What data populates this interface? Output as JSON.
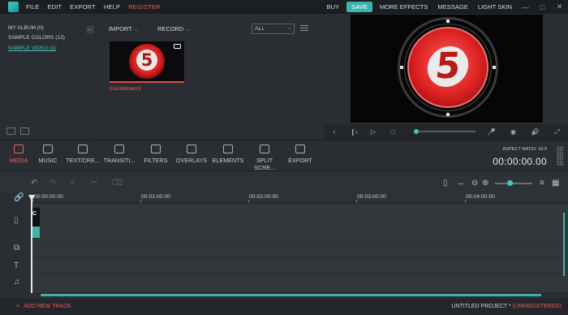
{
  "menu": {
    "items": [
      "FILE",
      "EDIT",
      "EXPORT",
      "HELP"
    ],
    "register": "REGISTER"
  },
  "topbar": {
    "buy": "BUY",
    "save": "SAVE",
    "more_effects": "MORE EFFECTS",
    "message": "MESSAGE",
    "light_skin": "LIGHT SKIN"
  },
  "sidebar": {
    "items": [
      {
        "label": "MY ALBUM (0)"
      },
      {
        "label": "SAMPLE COLORS (13)"
      },
      {
        "label": "SAMPLE VIDEO (1)",
        "active": true
      }
    ]
  },
  "media": {
    "import_label": "IMPORT",
    "record_label": "RECORD",
    "filter_value": "ALL",
    "clip_name": "Countdown3",
    "thumb_digit": "5"
  },
  "preview": {
    "digit": "5"
  },
  "tools": [
    {
      "label": "MEDIA",
      "icon": "folder-icon",
      "active": true
    },
    {
      "label": "MUSIC",
      "icon": "music-note-icon"
    },
    {
      "label": "TEXT/CRE...",
      "icon": "text-icon"
    },
    {
      "label": "TRANSITI...",
      "icon": "transition-icon"
    },
    {
      "label": "FILTERS",
      "icon": "filters-icon"
    },
    {
      "label": "OVERLAYS",
      "icon": "overlays-icon"
    },
    {
      "label": "ELEMENTS",
      "icon": "image-icon"
    },
    {
      "label": "SPLIT SCRE...",
      "icon": "split-screen-icon"
    },
    {
      "label": "EXPORT",
      "icon": "export-icon"
    }
  ],
  "aspect_ratio": "ASPECT RATIO: 16:9",
  "timecode": "00:00:00.00",
  "timeline": {
    "ruler": [
      "00:00:00:00",
      "00:01:00:00",
      "00:02:00:00",
      "00:03:00:00",
      "00:04:00:00"
    ],
    "clip_label": "C"
  },
  "footer": {
    "add_track": "ADD NEW TRACK",
    "project_name": "UNTITLED PROJECT *",
    "unregistered": "(UNREGISTERED)"
  },
  "colors": {
    "accent": "#3fc8c0",
    "alert": "#ef5b5b",
    "background": "#2a2e33"
  }
}
